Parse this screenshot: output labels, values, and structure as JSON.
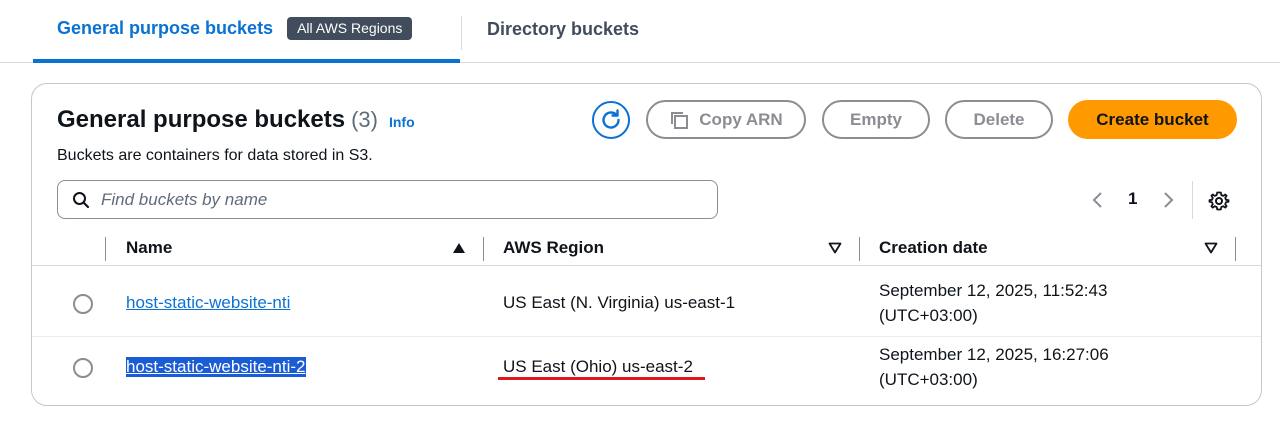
{
  "tabs": {
    "general": "General purpose buckets",
    "badge": "All AWS Regions",
    "directory": "Directory buckets"
  },
  "panel": {
    "title": "General purpose buckets",
    "count": "(3)",
    "info": "Info",
    "description": "Buckets are containers for data stored in S3."
  },
  "actions": {
    "copy_arn": "Copy ARN",
    "empty": "Empty",
    "delete": "Delete",
    "create": "Create bucket"
  },
  "search": {
    "placeholder": "Find buckets by name"
  },
  "pagination": {
    "current_page": "1"
  },
  "table": {
    "columns": [
      "Name",
      "AWS Region",
      "Creation date"
    ],
    "rows": [
      {
        "name": "host-static-website-nti",
        "region": "US East (N. Virginia) us-east-1",
        "date_line1": "September 12, 2025, 11:52:43",
        "date_line2": "(UTC+03:00)"
      },
      {
        "name": "host-static-website-nti-2",
        "region": "US East (Ohio) us-east-2",
        "date_line1": "September 12, 2025, 16:27:06",
        "date_line2": "(UTC+03:00)"
      }
    ]
  },
  "colors": {
    "accent": "#0972d3",
    "primary_button": "#ff9900",
    "annotation": "#e0161d"
  },
  "icons": [
    "refresh-icon",
    "copy-icon",
    "search-icon",
    "chevron-left-icon",
    "chevron-right-icon",
    "settings-gear-icon",
    "sort-ascending-icon",
    "sort-descending-icon"
  ]
}
